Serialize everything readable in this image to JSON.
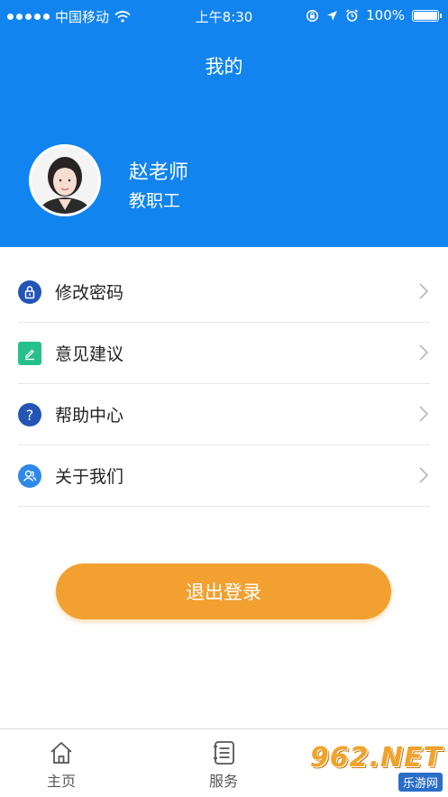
{
  "status_bar": {
    "carrier": "中国移动",
    "time": "上午8:30",
    "battery": "100%",
    "battery_level": 1.0
  },
  "header": {
    "title": "我的"
  },
  "profile": {
    "name": "赵老师",
    "role": "教职工"
  },
  "menu": {
    "items": [
      {
        "label": "修改密码",
        "icon": "lock-icon",
        "color": "#2355b6"
      },
      {
        "label": "意见建议",
        "icon": "edit-icon",
        "color": "#26c08a"
      },
      {
        "label": "帮助中心",
        "icon": "question-icon",
        "color": "#2355b6"
      },
      {
        "label": "关于我们",
        "icon": "people-icon",
        "color": "#2f88e8"
      }
    ]
  },
  "logout": {
    "label": "退出登录",
    "color": "#f2a030"
  },
  "tabbar": {
    "tabs": [
      {
        "label": "主页",
        "icon": "home-icon"
      },
      {
        "label": "服务",
        "icon": "service-list-icon"
      }
    ]
  },
  "watermark": {
    "brand": "962.NET",
    "site": "乐游网"
  },
  "colors": {
    "primary": "#1184f0",
    "accent": "#f2a030"
  }
}
